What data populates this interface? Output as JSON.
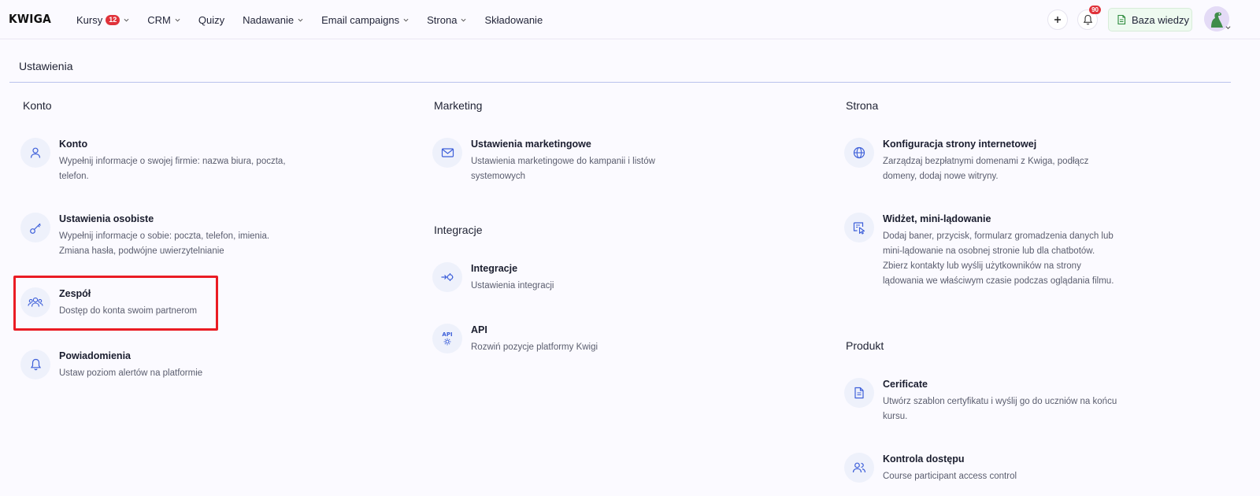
{
  "app": {
    "logo": "KWIGA"
  },
  "nav": {
    "items": [
      {
        "label": "Kursy",
        "badge": "12",
        "dropdown": true
      },
      {
        "label": "CRM",
        "dropdown": true
      },
      {
        "label": "Quizy",
        "dropdown": false
      },
      {
        "label": "Nadawanie",
        "dropdown": true
      },
      {
        "label": "Email campaigns",
        "dropdown": true
      },
      {
        "label": "Strona",
        "dropdown": true
      },
      {
        "label": "Składowanie",
        "dropdown": false
      }
    ]
  },
  "toolbar": {
    "add_icon": "plus-icon",
    "notifications_count": "90",
    "knowledge_base_label": "Baza wiedzy"
  },
  "page": {
    "title": "Ustawienia"
  },
  "sections": {
    "konto": {
      "title": "Konto",
      "items": [
        {
          "title": "Konto",
          "description": "Wypełnij informacje o swojej firmie: nazwa biura, poczta, telefon.",
          "icon": "user-icon"
        },
        {
          "title": "Ustawienia osobiste",
          "description": "Wypełnij informacje o sobie: poczta, telefon, imienia. Zmiana hasła, podwójne uwierzytelnianie",
          "icon": "key-icon"
        },
        {
          "title": "Zespół",
          "description": "Dostęp do konta swoim partnerom",
          "icon": "team-icon"
        },
        {
          "title": "Powiadomienia",
          "description": "Ustaw poziom alertów na platformie",
          "icon": "bell-icon"
        }
      ]
    },
    "marketing": {
      "title": "Marketing",
      "items": [
        {
          "title": "Ustawienia marketingowe",
          "description": "Ustawienia marketingowe do kampanii i listów systemowych",
          "icon": "mail-icon"
        }
      ]
    },
    "integracje": {
      "title": "Integracje",
      "items": [
        {
          "title": "Integracje",
          "description": "Ustawienia integracji",
          "icon": "integration-icon"
        },
        {
          "title": "API",
          "description": "Rozwiń pozycje platformy Kwigi",
          "icon": "api-icon",
          "icon_text": "API"
        }
      ]
    },
    "strona": {
      "title": "Strona",
      "items": [
        {
          "title": "Konfiguracja strony internetowej",
          "description": "Zarządzaj bezpłatnymi domenami z Kwiga, podłącz domeny, dodaj nowe witryny.",
          "icon": "globe-icon"
        },
        {
          "title": "Widżet, mini-lądowanie",
          "description": "Dodaj baner, przycisk, formularz gromadzenia danych lub mini-lądowanie na osobnej stronie lub dla chatbotów. Zbierz kontakty lub wyślij użytkowników na strony lądowania we właściwym czasie podczas oglądania filmu.",
          "icon": "widget-icon"
        }
      ]
    },
    "produkt": {
      "title": "Produkt",
      "items": [
        {
          "title": "Cerificate",
          "description": "Utwórz szablon certyfikatu i wyślij go do uczniów na końcu kursu.",
          "icon": "document-icon"
        },
        {
          "title": "Kontrola dostępu",
          "description": "Course participant access control",
          "icon": "users-icon"
        }
      ]
    }
  },
  "colors": {
    "accent": "#3d5fd9",
    "highlight": "#ea1c24",
    "badge": "#e0323a",
    "icon_bg": "#eef1fb"
  }
}
